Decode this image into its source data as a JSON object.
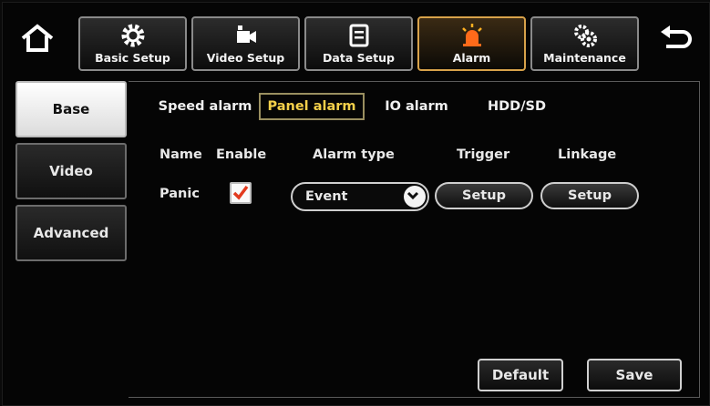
{
  "topbar": {
    "home_icon": "home-icon",
    "back_icon": "back-arrow-icon",
    "menu": [
      {
        "label": "Basic Setup",
        "icon": "gear-icon"
      },
      {
        "label": "Video Setup",
        "icon": "video-camera-icon"
      },
      {
        "label": "Data Setup",
        "icon": "data-panel-icon"
      },
      {
        "label": "Alarm",
        "icon": "alarm-siren-icon",
        "active": true
      },
      {
        "label": "Maintenance",
        "icon": "maintenance-gears-icon"
      }
    ],
    "active_color": "#f0a040"
  },
  "sidebar": {
    "tabs": [
      {
        "label": "Base",
        "active": true
      },
      {
        "label": "Video"
      },
      {
        "label": "Advanced"
      }
    ]
  },
  "subtabs": [
    {
      "label": "Speed alarm"
    },
    {
      "label": "Panel alarm",
      "active": true
    },
    {
      "label": "IO alarm"
    },
    {
      "label": "HDD/SD"
    }
  ],
  "table": {
    "headers": {
      "name": "Name",
      "enable": "Enable",
      "alarm_type": "Alarm type",
      "trigger": "Trigger",
      "linkage": "Linkage"
    },
    "row": {
      "name": "Panic",
      "enabled": true,
      "alarm_type": "Event",
      "trigger_button": "Setup",
      "linkage_button": "Setup"
    }
  },
  "footer": {
    "default_label": "Default",
    "save_label": "Save"
  },
  "colors": {
    "accent_yellow": "#f4d04a",
    "check_red": "#e23a1e",
    "background": "#050505"
  }
}
